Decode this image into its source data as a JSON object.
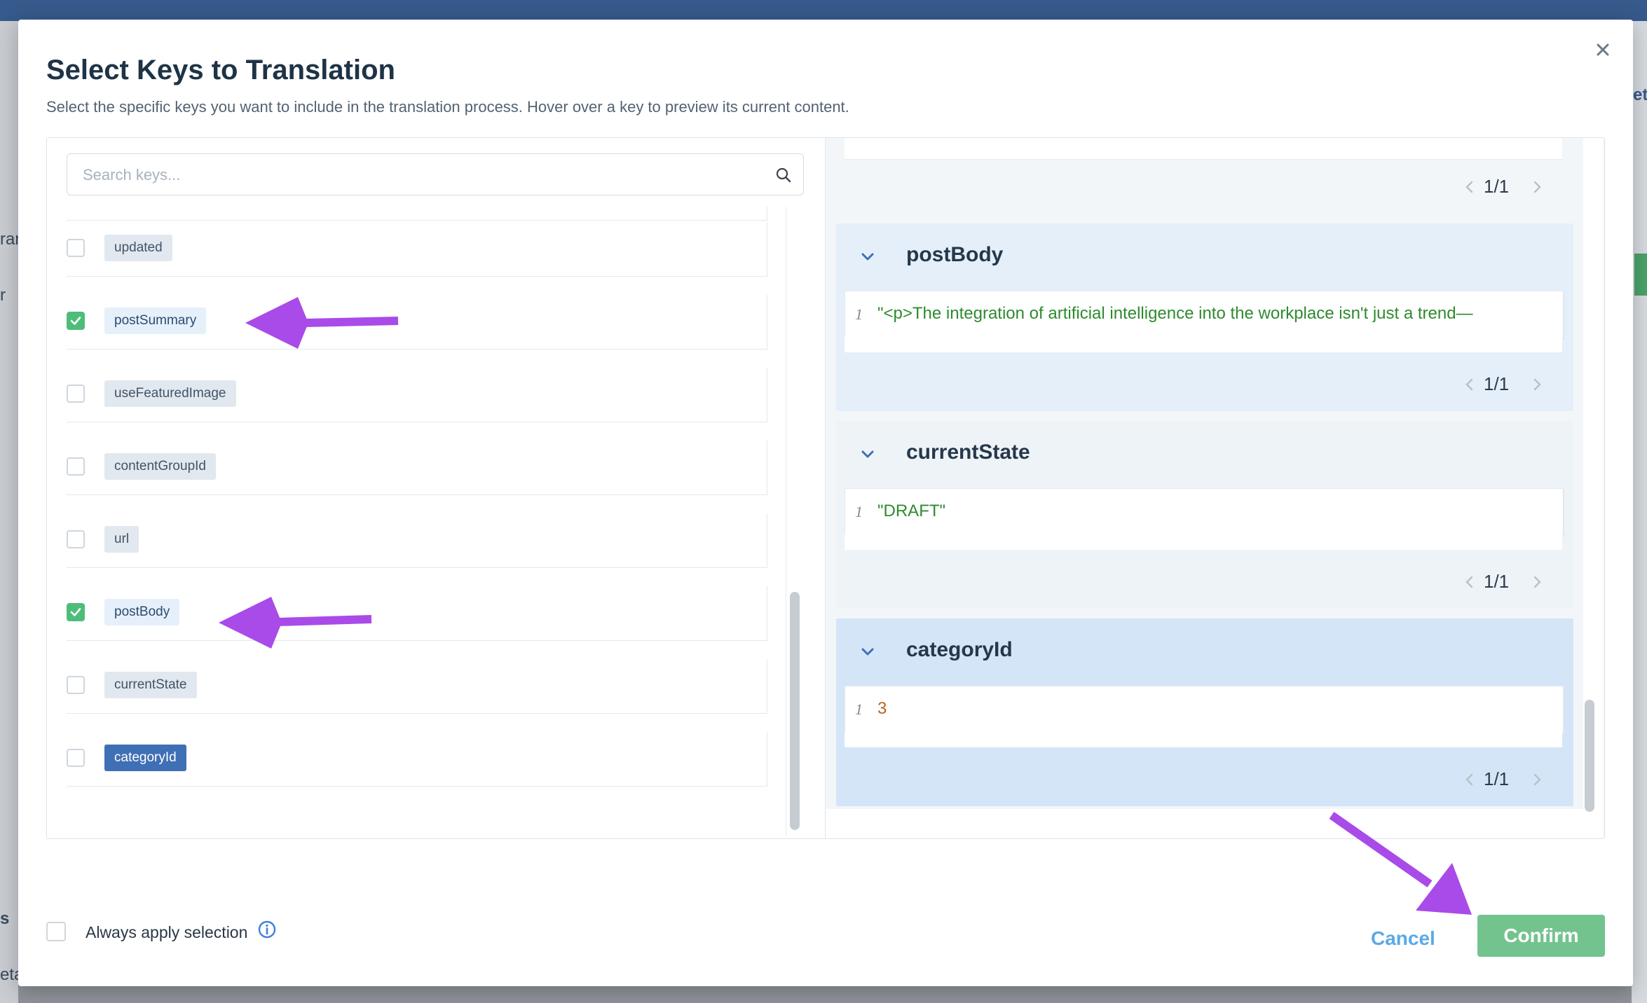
{
  "background": {
    "left_fragments": [
      "ran",
      "r",
      "s",
      "eta"
    ],
    "right_fragments": [
      "et"
    ]
  },
  "modal": {
    "title": "Select Keys to Translation",
    "subtitle": "Select the specific keys you want to include in the translation process. Hover over a key to preview its current content."
  },
  "search": {
    "placeholder": "Search keys..."
  },
  "keys": [
    {
      "label": "updated",
      "checked": false,
      "state": "default"
    },
    {
      "label": "postSummary",
      "checked": true,
      "state": "selected"
    },
    {
      "label": "useFeaturedImage",
      "checked": false,
      "state": "default"
    },
    {
      "label": "contentGroupId",
      "checked": false,
      "state": "default"
    },
    {
      "label": "url",
      "checked": false,
      "state": "default"
    },
    {
      "label": "postBody",
      "checked": true,
      "state": "selected"
    },
    {
      "label": "currentState",
      "checked": false,
      "state": "default"
    },
    {
      "label": "categoryId",
      "checked": false,
      "state": "active"
    }
  ],
  "previews": {
    "top_pager": "1/1",
    "cards": [
      {
        "title": "postBody",
        "line": "1",
        "value": "\"<p>The integration of artificial intelligence into the workplace isn't just a trend—",
        "value_color": "#2e8b2e",
        "pager": "1/1",
        "bg": "#e4effa"
      },
      {
        "title": "currentState",
        "line": "1",
        "value": "\"DRAFT\"",
        "value_color": "#2e8b2e",
        "pager": "1/1",
        "bg": "#eef3f8"
      },
      {
        "title": "categoryId",
        "line": "1",
        "value": "3",
        "value_color": "#b5651d",
        "pager": "1/1",
        "bg": "#d5e5f8"
      }
    ]
  },
  "footer": {
    "always_apply_label": "Always apply selection",
    "cancel_label": "Cancel",
    "confirm_label": "Confirm"
  },
  "colors": {
    "accent": "#3f6fb5",
    "check": "#4ebd7a",
    "confirm": "#73c38e",
    "annotation_arrow": "#a94be8"
  },
  "icons": [
    "close-icon",
    "search-icon",
    "check-icon",
    "chevron-down-icon",
    "chevron-left-icon",
    "chevron-right-icon",
    "info-icon",
    "annotation-arrow"
  ]
}
